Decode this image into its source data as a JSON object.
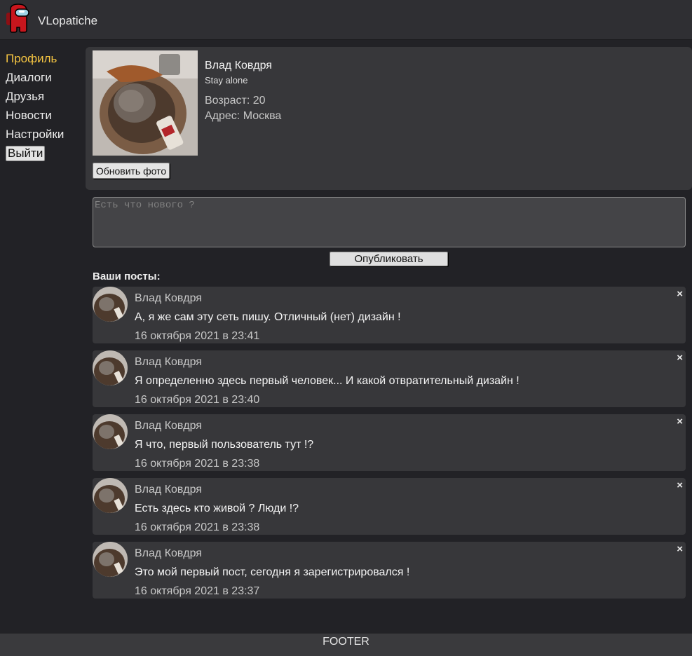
{
  "header": {
    "title": "VLopatiche",
    "logo_icon": "among-us-crewmate-icon",
    "colors": {
      "logo_red": "#c8161d",
      "logo_visor": "#9fd3e6"
    }
  },
  "sidebar": {
    "items": [
      {
        "label": "Профиль",
        "active": true
      },
      {
        "label": "Диалоги"
      },
      {
        "label": "Друзья"
      },
      {
        "label": "Новости"
      },
      {
        "label": "Настройки"
      }
    ],
    "logout_label": "Выйти",
    "colors": {
      "active": "#f5c542"
    }
  },
  "profile": {
    "name": "Влад Ковдря",
    "status": "Stay alone",
    "age": "Возраст: 20",
    "address": "Адрес: Москва",
    "update_photo_label": "Обновить фото"
  },
  "new_post": {
    "placeholder": "Есть что нового ?",
    "publish_label": "Опубликовать",
    "posts_heading": "Ваши посты:"
  },
  "posts": [
    {
      "author": "Влад Ковдря",
      "text": "А, я же сам эту сеть пишу. Отличный (нет) дизайн !",
      "date": "16 октября 2021 в 23:41",
      "close": "×"
    },
    {
      "author": "Влад Ковдря",
      "text": "Я определенно здесь первый человек... И какой отвратительный дизайн !",
      "date": "16 октября 2021 в 23:40",
      "close": "×"
    },
    {
      "author": "Влад Ковдря",
      "text": "Я что, первый пользователь тут !?",
      "date": "16 октября 2021 в 23:38",
      "close": "×"
    },
    {
      "author": "Влад Ковдря",
      "text": "Есть здесь кто живой ? Люди !?",
      "date": "16 октября 2021 в 23:38",
      "close": "×"
    },
    {
      "author": "Влад Ковдря",
      "text": "Это мой первый пост, сегодня я зарегистрировался !",
      "date": "16 октября 2021 в 23:37",
      "close": "×"
    }
  ],
  "footer": {
    "text": "FOOTER"
  }
}
